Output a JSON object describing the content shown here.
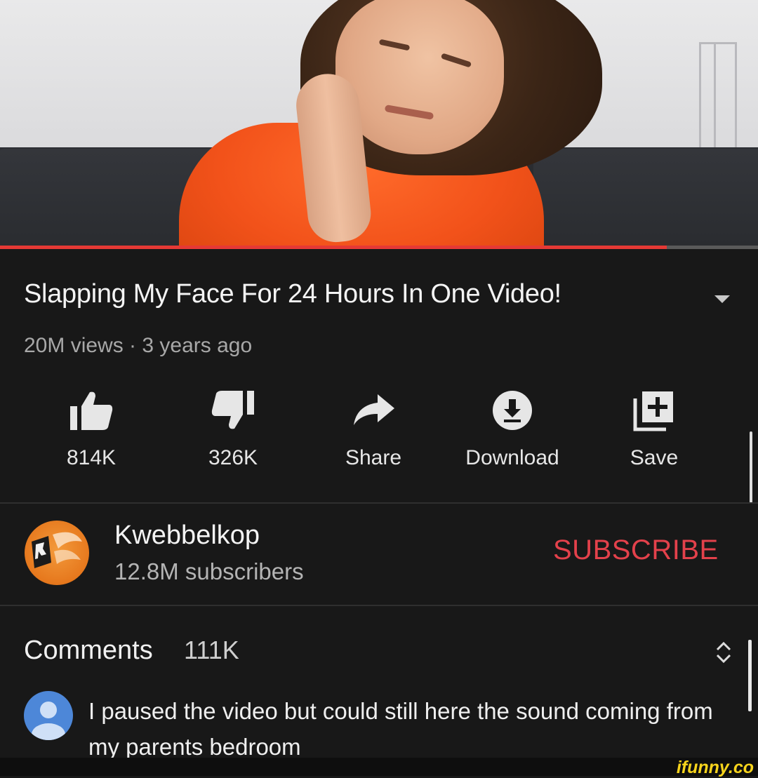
{
  "video": {
    "title": "Slapping My Face For 24 Hours In One Video!",
    "meta": "20M views · 3 years ago",
    "progress_fraction": 0.88
  },
  "actions": [
    {
      "label": "814K",
      "icon": "thumbs-up-icon"
    },
    {
      "label": "326K",
      "icon": "thumbs-down-icon"
    },
    {
      "label": "Share",
      "icon": "share-icon"
    },
    {
      "label": "Download",
      "icon": "download-icon"
    },
    {
      "label": "Save",
      "icon": "save-playlist-icon"
    }
  ],
  "channel": {
    "name": "Kwebbelkop",
    "subscribers": "12.8M subscribers",
    "subscribe_label": "SUBSCRIBE"
  },
  "comments": {
    "title": "Comments",
    "count": "111K",
    "first": {
      "text": "I paused the video but could still here the sound coming from my parents bedroom"
    }
  },
  "watermark": "ifunny.co",
  "colors": {
    "background": "#181818",
    "subscribe": "#e3414b",
    "progress": "#e53935",
    "user_avatar": "#4d87d8",
    "watermark": "#f7d41c"
  }
}
